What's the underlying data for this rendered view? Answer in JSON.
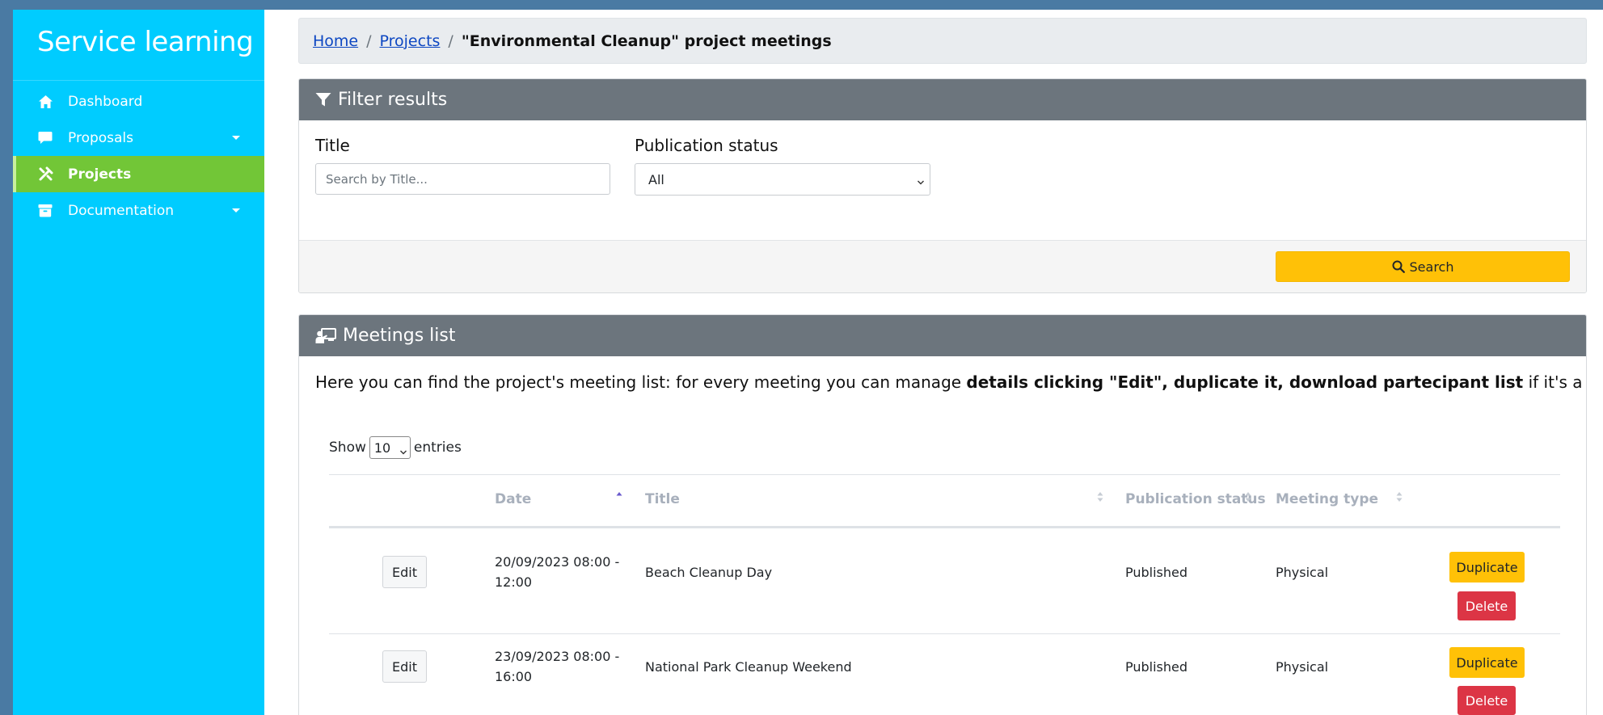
{
  "app": {
    "brand": "Service learning"
  },
  "sidebar": {
    "items": [
      {
        "label": "Dashboard",
        "icon": "home-icon"
      },
      {
        "label": "Proposals",
        "icon": "comment-icon",
        "has_submenu": true
      },
      {
        "label": "Projects",
        "icon": "tools-icon",
        "active": true
      },
      {
        "label": "Documentation",
        "icon": "archive-icon",
        "has_submenu": true
      }
    ]
  },
  "breadcrumb": {
    "home": "Home",
    "projects": "Projects",
    "separator": "/",
    "current": "\"Environmental Cleanup\" project meetings"
  },
  "filter": {
    "header": "Filter results",
    "title_label": "Title",
    "title_placeholder": "Search by Title...",
    "title_value": "",
    "status_label": "Publication status",
    "status_value": "All",
    "search_button": "Search"
  },
  "meetings": {
    "header": "Meetings list",
    "intro_prefix": "Here you can find the project's meeting list: for every meeting you can manage ",
    "intro_bold": "details clicking \"Edit\", duplicate it, download partecipant list",
    "intro_suffix": " if it's a virtual meeting.",
    "show_label": "Show",
    "entries_value": "10",
    "entries_label": "entries",
    "columns": {
      "date": "Date",
      "title": "Title",
      "status": "Publication status",
      "type": "Meeting type"
    },
    "sort": {
      "column": "Date",
      "direction": "ascending"
    },
    "rows": [
      {
        "edit": "Edit",
        "date_line1": "20/09/2023 08:00 -",
        "date_line2": "12:00",
        "title": "Beach Cleanup Day",
        "status": "Published",
        "type": "Physical",
        "duplicate": "Duplicate",
        "delete": "Delete"
      },
      {
        "edit": "Edit",
        "date_line1": "23/09/2023 08:00 -",
        "date_line2": "16:00",
        "title": "National Park Cleanup Weekend",
        "status": "Published",
        "type": "Physical",
        "duplicate": "Duplicate",
        "delete": "Delete"
      }
    ]
  },
  "colors": {
    "sidebar": "#00ccff",
    "sidebar_active": "#72c637",
    "card_header": "#6c757d",
    "warning": "#ffc107",
    "danger": "#dc3545",
    "link": "#0d47c2",
    "page_frame": "#4a7aa3"
  }
}
